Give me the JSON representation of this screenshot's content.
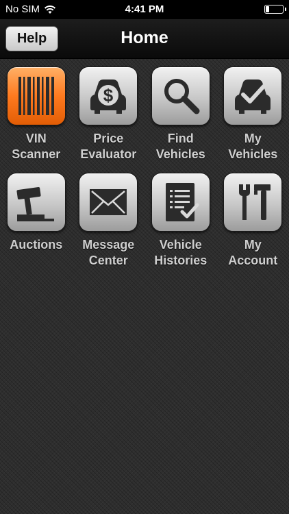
{
  "status_bar": {
    "carrier": "No SIM",
    "time": "4:41 PM"
  },
  "nav": {
    "title": "Home",
    "help_label": "Help"
  },
  "tiles": [
    {
      "line1": "VIN",
      "line2": "Scanner",
      "icon": "barcode-icon"
    },
    {
      "line1": "Price",
      "line2": "Evaluator",
      "icon": "price-car-icon"
    },
    {
      "line1": "Find",
      "line2": "Vehicles",
      "icon": "magnifier-icon"
    },
    {
      "line1": "My",
      "line2": "Vehicles",
      "icon": "car-check-icon"
    },
    {
      "line1": "Auctions",
      "line2": "",
      "icon": "gavel-icon"
    },
    {
      "line1": "Message",
      "line2": "Center",
      "icon": "envelope-icon"
    },
    {
      "line1": "Vehicle",
      "line2": "Histories",
      "icon": "checklist-icon"
    },
    {
      "line1": "My",
      "line2": "Account",
      "icon": "tools-icon"
    }
  ],
  "colors": {
    "accent_orange": "#ff7a1f",
    "icon_glyph": "#2b2b2b",
    "label": "#cfcfcf"
  }
}
